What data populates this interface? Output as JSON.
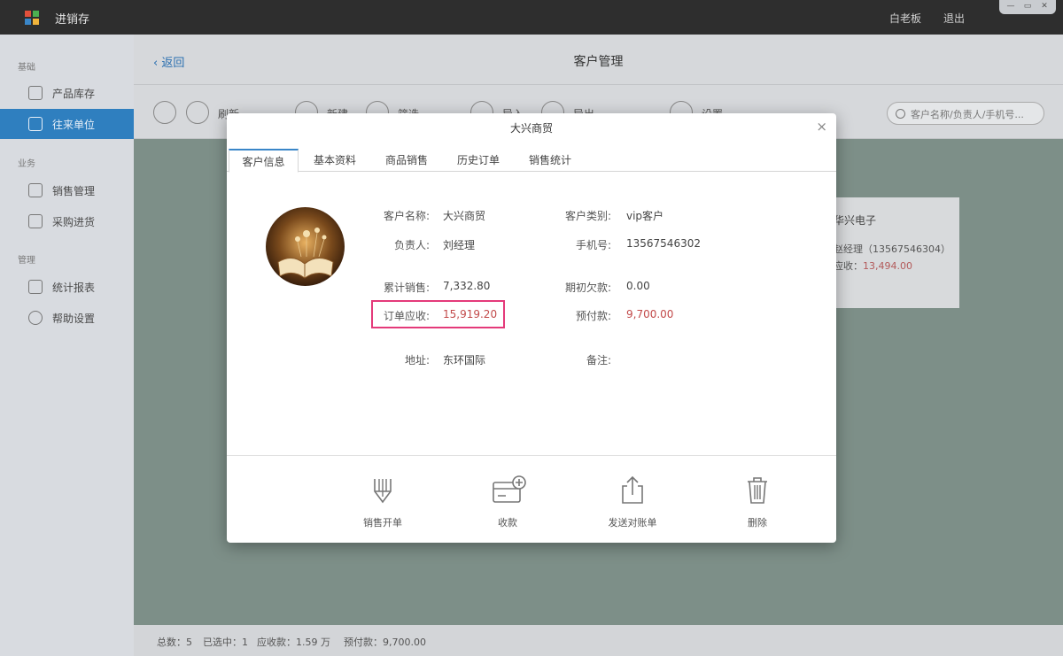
{
  "titlebar": {
    "app_title": "进销存",
    "user": "白老板",
    "logout": "退出"
  },
  "sidebar": {
    "sections": [
      "基础",
      "业务",
      "管理"
    ],
    "items": [
      {
        "label": "产品库存",
        "icon": "tag-icon"
      },
      {
        "label": "往来单位",
        "icon": "contacts-icon"
      },
      {
        "label": "销售管理",
        "icon": "edit-icon"
      },
      {
        "label": "采购进货",
        "icon": "inbox-icon"
      },
      {
        "label": "统计报表",
        "icon": "chart-icon"
      },
      {
        "label": "帮助设置",
        "icon": "gear-icon"
      }
    ]
  },
  "main": {
    "back": "返回",
    "title": "客户管理",
    "toolbar": [
      "刷新",
      "新建",
      "筛选",
      "导入",
      "导出",
      "设置"
    ],
    "search_placeholder": "客户名称/负责人/手机号...",
    "bg_card": {
      "name": "华兴电子",
      "person": "赵经理（13567546304）",
      "receivable_label": "应收：",
      "receivable": "13,494.00"
    },
    "status": {
      "total": "总数：5",
      "selected": "已选中：1",
      "receivable": "应收款：1.59 万",
      "prepaid": "预付款：9,700.00"
    }
  },
  "modal": {
    "title": "大兴商贸",
    "close": "×",
    "tabs": [
      "客户信息",
      "基本资料",
      "商品销售",
      "历史订单",
      "销售统计"
    ],
    "fields": {
      "name_label": "客户名称:",
      "name": "大兴商贸",
      "type_label": "客户类别:",
      "type": "vip客户",
      "owner_label": "负责人:",
      "owner": "刘经理",
      "phone_label": "手机号:",
      "phone": "13567546302",
      "total_sales_label": "累计销售:",
      "total_sales": "7,332.80",
      "opening_debt_label": "期初欠款:",
      "opening_debt": "0.00",
      "order_receivable_label": "订单应收:",
      "order_receivable": "15,919.20",
      "prepaid_label": "预付款:",
      "prepaid": "9,700.00",
      "address_label": "地址:",
      "address": "东环国际",
      "note_label": "备注:"
    },
    "actions": [
      {
        "label": "销售开单",
        "icon": "pencil-icon"
      },
      {
        "label": "收款",
        "icon": "card-add-icon"
      },
      {
        "label": "发送对账单",
        "icon": "share-icon"
      },
      {
        "label": "删除",
        "icon": "trash-icon"
      }
    ]
  }
}
